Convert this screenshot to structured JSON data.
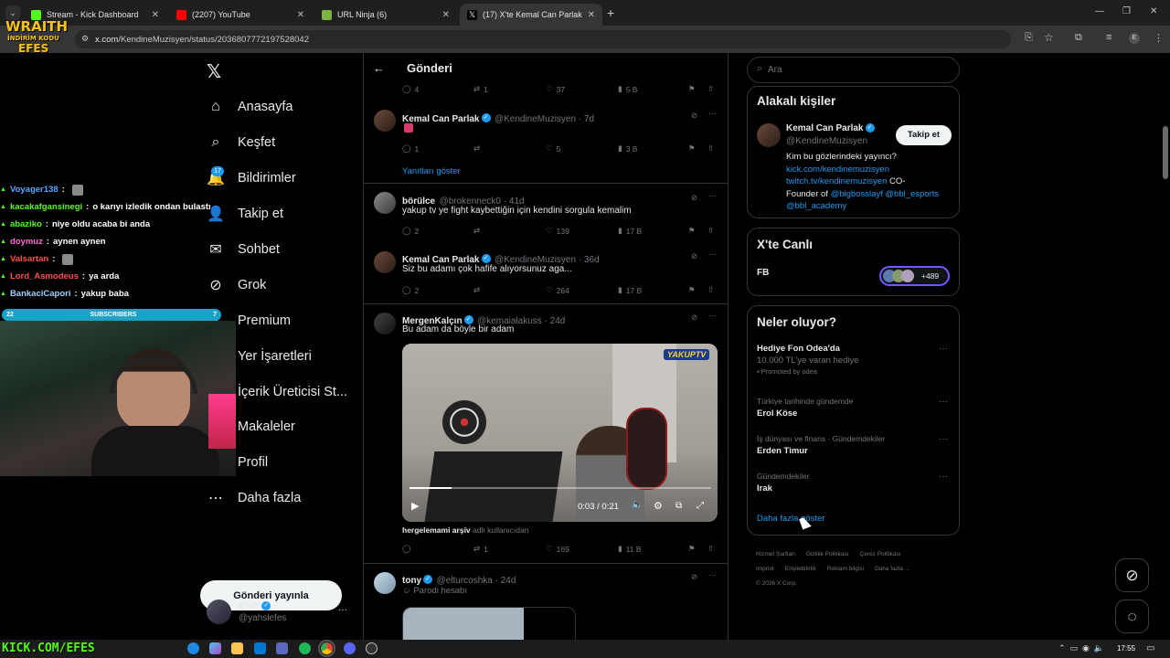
{
  "browser": {
    "tabs": [
      {
        "title": "Stream - Kick Dashboard",
        "color": "#53fc18"
      },
      {
        "title": "(2207) YouTube",
        "color": "#ff0000"
      },
      {
        "title": "URL Ninja (6)",
        "color": "#7cb342"
      },
      {
        "title": "(17) X'te Kemal Can Parlak:",
        "color": "#ffffff"
      }
    ],
    "new_tab": "+",
    "url_host": "x.com",
    "url_path": "/KendineMuzisyen/status/2036807772197528042",
    "window_controls": [
      "—",
      "❐",
      "✕"
    ]
  },
  "overlay": {
    "brand_top": "WRAITH",
    "brand_mid": "İNDİRİM KODU",
    "brand_bottom": "EFES",
    "chat": [
      {
        "user": "Voyager138",
        "color": "#5aa9ff",
        "msg": ""
      },
      {
        "user": "kacakafgansinegi",
        "color": "#53fc18",
        "msg": "o karıyı izledik ondan bulastı"
      },
      {
        "user": "abaziko",
        "color": "#53fc18",
        "msg": "niye oldu acaba bi anda"
      },
      {
        "user": "doymuz",
        "color": "#ff6bd6",
        "msg": "aynen aynen"
      },
      {
        "user": "Valsartan",
        "color": "#ff4d4d",
        "msg": ""
      },
      {
        "user": "Lord_Asmodeus",
        "color": "#ff4d4d",
        "msg": "ya arda"
      },
      {
        "user": "BankaciCapori",
        "color": "#9fd4ff",
        "msg": "yakup baba"
      }
    ],
    "sub_left": "22",
    "sub_label": "SUBSCRIBERS",
    "sub_right": "7",
    "kick_link": "KICK.COM/EFES"
  },
  "nav": {
    "items": [
      {
        "label": "Anasayfa",
        "icon": "⌂"
      },
      {
        "label": "Keşfet",
        "icon": "⌕"
      },
      {
        "label": "Bildirimler",
        "icon": "🔔"
      },
      {
        "label": "Takip et",
        "icon": "👤"
      },
      {
        "label": "Sohbet",
        "icon": "✉"
      },
      {
        "label": "Grok",
        "icon": "⊘"
      },
      {
        "label": "Premium",
        "icon": "X"
      },
      {
        "label": "Yer İşaretleri",
        "icon": "⚑"
      },
      {
        "label": "İçerik Üreticisi St...",
        "icon": "▦"
      },
      {
        "label": "Makaleler",
        "icon": "▤"
      },
      {
        "label": "Profil",
        "icon": "◯"
      },
      {
        "label": "Daha fazla",
        "icon": "⋯"
      }
    ],
    "notif_badge": "17",
    "post_button": "Gönderi yayınla",
    "account_name": "EfeS",
    "account_handle": "@yahslefes",
    "account_more": "···"
  },
  "timeline": {
    "header": "Gönderi",
    "top_stats": {
      "reply": "4",
      "repost": "1",
      "like": "37",
      "views": "5 B"
    },
    "replies": [
      {
        "name": "Kemal Can Parlak",
        "handle": "@KendineMuzisyen · 7d",
        "text": "",
        "reply": "1",
        "repost": "",
        "like": "5",
        "views": "3 B"
      },
      {
        "name": "börülce",
        "handle": "@brokenneck0 · 41d",
        "text": "yakup tv ye fight kaybettiğin için kendini sorgula kemalim",
        "reply": "2",
        "repost": "",
        "like": "139",
        "views": "17 B"
      },
      {
        "name": "Kemal Can Parlak",
        "handle": "@KendineMuzisyen · 36d",
        "text": "Siz bu adamı çok hafife alıyorsunuz aga...",
        "reply": "2",
        "repost": "",
        "like": "264",
        "views": "17 B"
      },
      {
        "name": "MergenKalçın",
        "handle": "@kemaialakuss · 24d",
        "text": "Bu adam da böyle bir adam",
        "reply": "",
        "repost": "1",
        "like": "169",
        "views": "11 B"
      },
      {
        "name": "tony",
        "handle": "@elturcoshka · 24d",
        "text": "Parodi hesabı",
        "reply": "",
        "repost": "",
        "like": "",
        "views": ""
      }
    ],
    "show_replies": "Yanıtları göster",
    "video_time": "0:03 / 0:21",
    "video_progress": 0.14,
    "video_watermark": "YAKUPTV",
    "video_source": "hergelemami arşiv",
    "video_source_suffix": "adlı kullanıcıdan"
  },
  "sidebar": {
    "search_placeholder": "Ara",
    "related_title": "Alakalı kişiler",
    "person_name": "Kemal Can Parlak",
    "person_handle": "@KendineMuzisyen",
    "follow_button": "Takip et",
    "bio_line1": "Kim bu gözlerindeki yayıncı?",
    "bio_link1": "kick.com/kendinemuzisyen",
    "bio_link2": "twitch.tv/kendinemuzisyen",
    "bio_co": "CO-",
    "bio_founder": "Founder of",
    "bio_m1": "@bigbosslayf",
    "bio_m2": "@bbl_esports",
    "bio_m3": "@bbl_academy",
    "live_title": "X'te Canlı",
    "live_label": "FB",
    "live_count": "+489",
    "trends_title": "Neler oluyor?",
    "trends": [
      {
        "context": "",
        "title": "Hediye Fon Odea'da",
        "sub": "10.000 TL'ye varan hediye",
        "promo": "Promoted by odea"
      },
      {
        "context": "Türkiye tarihinde gündemde",
        "title": "Erol Köse",
        "sub": "",
        "promo": ""
      },
      {
        "context": "İş dünyası ve finans · Gündemdekiler",
        "title": "Erden Timur",
        "sub": "",
        "promo": ""
      },
      {
        "context": "Gündemdekiler",
        "title": "Irak",
        "sub": "",
        "promo": ""
      }
    ],
    "show_more": "Daha fazla göster",
    "footer": [
      "Hizmet Şartları",
      "Gizlilik Politikası",
      "Çerez Politikası",
      "Imprint",
      "Erişilebilirlik",
      "Reklam bilgisi",
      "Daha fazla ...",
      "© 2026 X Corp."
    ]
  },
  "taskbar": {
    "time": "17:55"
  }
}
